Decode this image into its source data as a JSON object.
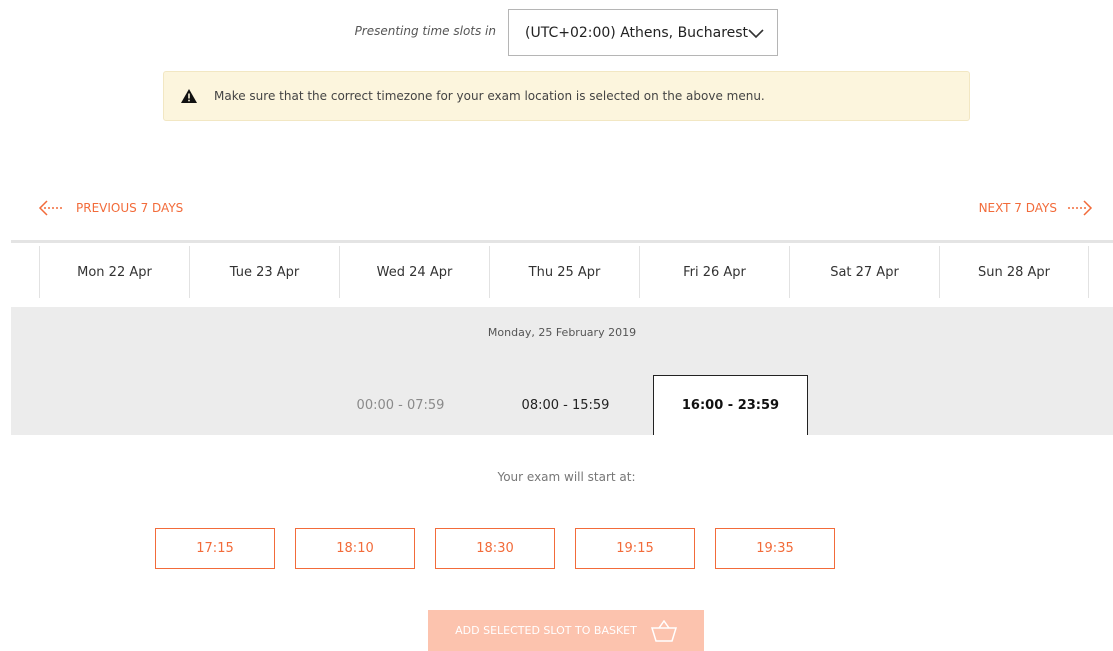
{
  "timezone": {
    "label": "Presenting time slots in",
    "selected": "(UTC+02:00) Athens, Bucharest"
  },
  "warning": {
    "text": "Make sure that the correct timezone for your exam location is selected on the above menu."
  },
  "navigation": {
    "previous_label": "PREVIOUS 7 DAYS",
    "next_label": "NEXT 7 DAYS"
  },
  "days": [
    "Mon 22 Apr",
    "Tue 23 Apr",
    "Wed 24 Apr",
    "Thu 25 Apr",
    "Fri 26 Apr",
    "Sat 27 Apr",
    "Sun 28 Apr"
  ],
  "panel": {
    "date": "Monday, 25 February 2019",
    "ranges": [
      "00:00 - 07:59",
      "08:00 - 15:59",
      "16:00 - 23:59"
    ],
    "selected_range": "16:00 - 23:59"
  },
  "start_times": {
    "caption": "Your exam will start at:",
    "slots": [
      "17:15",
      "18:10",
      "18:30",
      "19:15",
      "19:35"
    ]
  },
  "basket": {
    "label": "ADD SELECTED SLOT TO BASKET"
  },
  "colors": {
    "accent": "#f26b3a",
    "accent_disabled": "#fcc3ae",
    "warning_bg": "#fcf5dd",
    "panel_bg": "#ececec"
  },
  "icons": {
    "timezone_dropdown": "chevron-down-icon",
    "warning": "warning-triangle-icon",
    "previous": "arrow-left-icon",
    "next": "arrow-right-icon",
    "basket": "basket-icon"
  }
}
